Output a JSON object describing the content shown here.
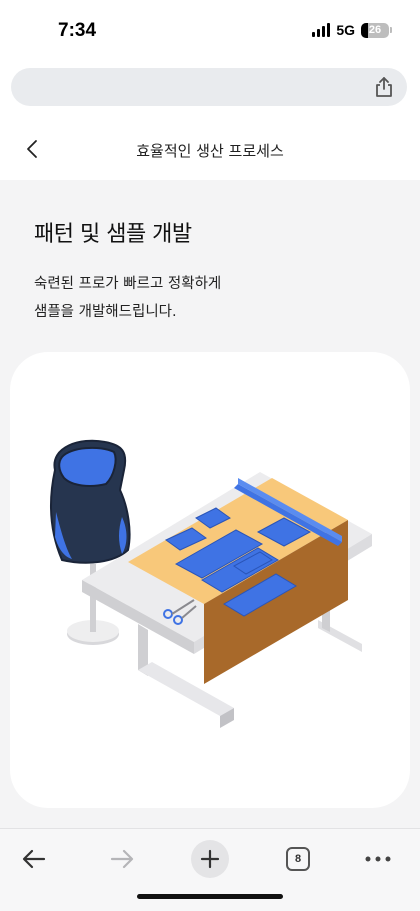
{
  "status_bar": {
    "time": "7:34",
    "network": "5G",
    "battery_level": "26",
    "icons": [
      "signal-icon",
      "battery-icon"
    ]
  },
  "url_bar": {
    "share_icon": "share-icon"
  },
  "page_header": {
    "title": "효율적인 생산 프로세스",
    "back_icon": "chevron-left-icon"
  },
  "section": {
    "title": "패턴 및 샘플 개발",
    "description_lines": [
      "숙련된 프로가 빠르고 정확하게",
      "샘플을 개발해드립니다."
    ],
    "illustration": "pattern-table-illustration"
  },
  "toolbar": {
    "tab_count": "8",
    "icons": [
      "back-arrow-icon",
      "forward-arrow-icon",
      "plus-icon",
      "tabs-icon",
      "more-icon"
    ]
  },
  "colors": {
    "accent_blue": "#3f73e4",
    "table_orange": "#f8c87a",
    "cloth_brown": "#a8692a",
    "mannequin_navy": "#26354f"
  }
}
